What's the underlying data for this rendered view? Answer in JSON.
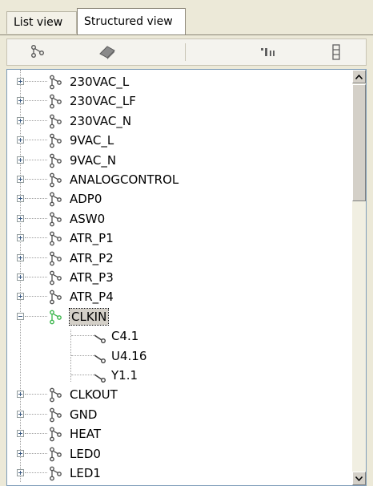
{
  "tabs": [
    {
      "label": "List view"
    },
    {
      "label": "Structured view"
    }
  ],
  "toolbar": {
    "buttons": [
      {
        "icon": "net-tree-icon"
      },
      {
        "icon": "component-icon"
      },
      {
        "icon": "sort-icon"
      },
      {
        "icon": "collapse-icon"
      }
    ]
  },
  "tree": {
    "nets": [
      {
        "label": "230VAC_L",
        "expanded": false
      },
      {
        "label": "230VAC_LF",
        "expanded": false
      },
      {
        "label": "230VAC_N",
        "expanded": false
      },
      {
        "label": "9VAC_L",
        "expanded": false
      },
      {
        "label": "9VAC_N",
        "expanded": false
      },
      {
        "label": "ANALOGCONTROL",
        "expanded": false
      },
      {
        "label": "ADP0",
        "expanded": false
      },
      {
        "label": "ASW0",
        "expanded": false
      },
      {
        "label": "ATR_P1",
        "expanded": false
      },
      {
        "label": "ATR_P2",
        "expanded": false
      },
      {
        "label": "ATR_P3",
        "expanded": false
      },
      {
        "label": "ATR_P4",
        "expanded": false
      },
      {
        "label": "CLKIN",
        "expanded": true,
        "selected": true,
        "children": [
          "C4.1",
          "U4.16",
          "Y1.1"
        ]
      },
      {
        "label": "CLKOUT",
        "expanded": false
      },
      {
        "label": "GND",
        "expanded": false
      },
      {
        "label": "HEAT",
        "expanded": false
      },
      {
        "label": "LED0",
        "expanded": false
      },
      {
        "label": "LED1",
        "expanded": false
      }
    ]
  },
  "colors": {
    "net_icon": "#505050",
    "net_icon_selected": "#39b54a",
    "selection_bg": "#d4d0c8"
  }
}
